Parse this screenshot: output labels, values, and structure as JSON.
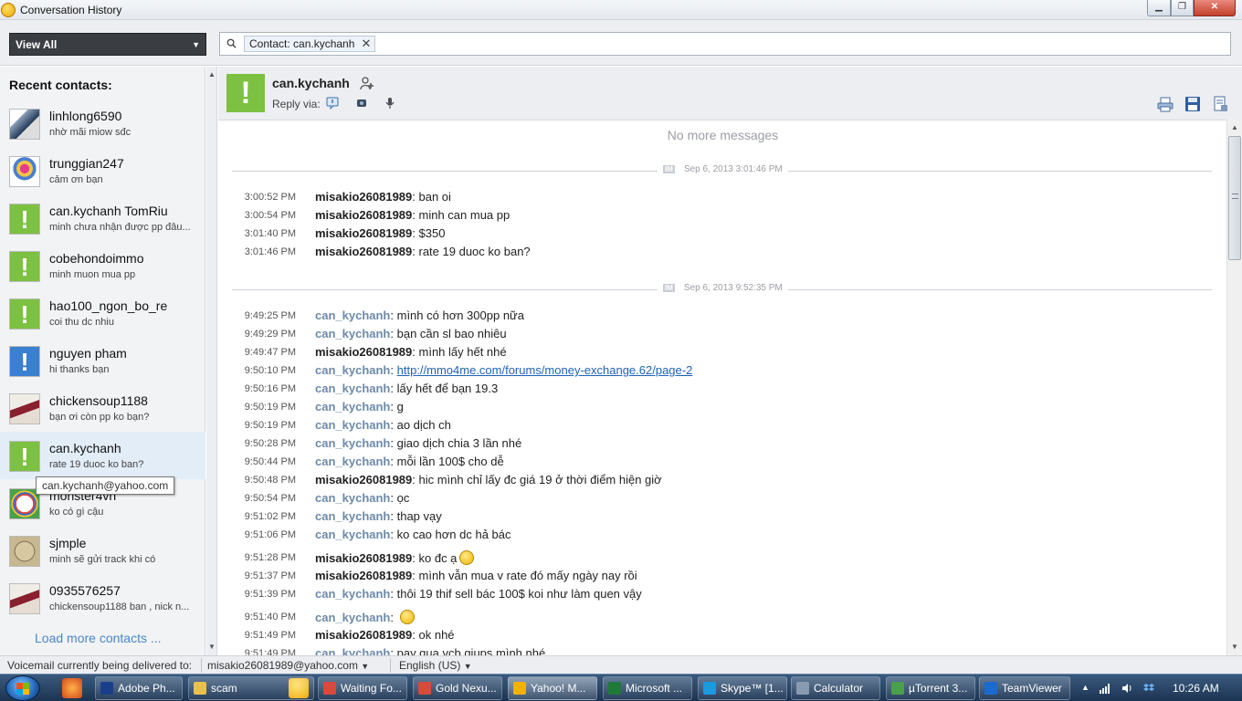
{
  "window": {
    "title": "Conversation History"
  },
  "toolbar": {
    "view_select": "View All",
    "search_chip": "Contact: can.kychanh"
  },
  "sidebar": {
    "title": "Recent contacts:",
    "contacts": [
      {
        "name": "linhlong6590",
        "sub": "nhờ mãi miow sđc"
      },
      {
        "name": "trunggian247",
        "sub": "cảm ơn bạn"
      },
      {
        "name": "can.kychanh TomRiu",
        "sub": "minh chưa nhận được pp đâu..."
      },
      {
        "name": "cobehondoimmo",
        "sub": "minh muon mua pp"
      },
      {
        "name": "hao100_ngon_bo_re",
        "sub": "coi thu dc nhiu"
      },
      {
        "name": "nguyen pham",
        "sub": "hi thanks bạn"
      },
      {
        "name": "chickensoup1188",
        "sub": "bạn ơi còn pp ko bạn?"
      },
      {
        "name": "can.kychanh",
        "sub": "rate 19 duoc ko ban?"
      },
      {
        "name": "monster4vn",
        "sub": "ko có gì cậu"
      },
      {
        "name": "sjmple",
        "sub": "minh sẽ gửi track khi có"
      },
      {
        "name": "0935576257",
        "sub": "chickensoup1188 ban , nick n..."
      }
    ],
    "load_more": "Load more contacts ...",
    "tooltip": "can.kychanh@yahoo.com"
  },
  "header": {
    "name": "can.kychanh",
    "reply_via": "Reply via:"
  },
  "conversation": {
    "no_more": "No more messages",
    "separators": [
      {
        "im": "IM",
        "date": "Sep 6, 2013 3:01:46 PM"
      },
      {
        "im": "IM",
        "date": "Sep 6, 2013 9:52:35 PM"
      }
    ],
    "messages": [
      {
        "time": "3:00:52 PM",
        "sender": "misakio26081989",
        "text": "ban oi"
      },
      {
        "time": "3:00:54 PM",
        "sender": "misakio26081989",
        "text": "minh can mua pp"
      },
      {
        "time": "3:01:40 PM",
        "sender": "misakio26081989",
        "text": "$350"
      },
      {
        "time": "3:01:46 PM",
        "sender": "misakio26081989",
        "text": "rate 19 duoc ko ban?"
      },
      {
        "time": "9:49:25 PM",
        "sender": "can_kychanh",
        "text": "mình có hơn 300pp nữa"
      },
      {
        "time": "9:49:29 PM",
        "sender": "can_kychanh",
        "text": "bạn cần sl bao nhiêu"
      },
      {
        "time": "9:49:47 PM",
        "sender": "misakio26081989",
        "text": "mình lấy hết nhé"
      },
      {
        "time": "9:50:10 PM",
        "sender": "can_kychanh",
        "link": "http://mmo4me.com/forums/money-exchange.62/page-2"
      },
      {
        "time": "9:50:16 PM",
        "sender": "can_kychanh",
        "text": "lấy hết để bạn 19.3"
      },
      {
        "time": "9:50:19 PM",
        "sender": "can_kychanh",
        "text": "g"
      },
      {
        "time": "9:50:19 PM",
        "sender": "can_kychanh",
        "text": "ao dịch ch"
      },
      {
        "time": "9:50:28 PM",
        "sender": "can_kychanh",
        "text": "giao dịch chia 3 lần nhé"
      },
      {
        "time": "9:50:44 PM",
        "sender": "can_kychanh",
        "text": "mỗi lần 100$ cho dễ"
      },
      {
        "time": "9:50:48 PM",
        "sender": "misakio26081989",
        "text": "hic mình chỉ lấy đc giá 19 ở thời điểm hiện giờ"
      },
      {
        "time": "9:50:54 PM",
        "sender": "can_kychanh",
        "text": "ọc"
      },
      {
        "time": "9:51:02 PM",
        "sender": "can_kychanh",
        "text": "thap vạy"
      },
      {
        "time": "9:51:06 PM",
        "sender": "can_kychanh",
        "text": "ko cao hơn dc hả bác"
      },
      {
        "time": "9:51:28 PM",
        "sender": "misakio26081989",
        "text": "ko đc ạ",
        "emoji": "confused-emoji-icon"
      },
      {
        "time": "9:51:37 PM",
        "sender": "misakio26081989",
        "text": "mình vẫn mua v rate đó mấy ngày nay rồi"
      },
      {
        "time": "9:51:39 PM",
        "sender": "can_kychanh",
        "text": "thôi 19 thif sell bác 100$ koi như làm quen vậy"
      },
      {
        "time": "9:51:40 PM",
        "sender": "can_kychanh",
        "text": "",
        "emoji": "smile-emoji-icon"
      },
      {
        "time": "9:51:49 PM",
        "sender": "misakio26081989",
        "text": "ok nhé"
      },
      {
        "time": "9:51:49 PM",
        "sender": "can_kychanh",
        "text": "pay qua vcb giups mình nhé"
      }
    ]
  },
  "statusbar": {
    "voicemail_label": "Voicemail currently being delivered to:",
    "email": "misakio26081989@yahoo.com",
    "language": "English (US)"
  },
  "taskbar": {
    "items": [
      {
        "label": "Adobe Ph...",
        "color": "#1a3f8a"
      },
      {
        "label": "scam",
        "color": "#e8c050"
      },
      {
        "label": "Waiting Fo...",
        "color": "#d94a3a"
      },
      {
        "label": "Gold Nexu...",
        "color": "#d94a3a"
      },
      {
        "label": "Yahoo! M...",
        "color": "#f0b400"
      },
      {
        "label": "Microsoft ...",
        "color": "#1f7a3a"
      },
      {
        "label": "Skype™ [1...",
        "color": "#1a9ae0"
      },
      {
        "label": "Calculator",
        "color": "#8a9ab0"
      },
      {
        "label": "µTorrent 3...",
        "color": "#4aa04a"
      },
      {
        "label": "TeamViewer",
        "color": "#1a6ad0"
      }
    ],
    "clock": "10:26 AM"
  }
}
